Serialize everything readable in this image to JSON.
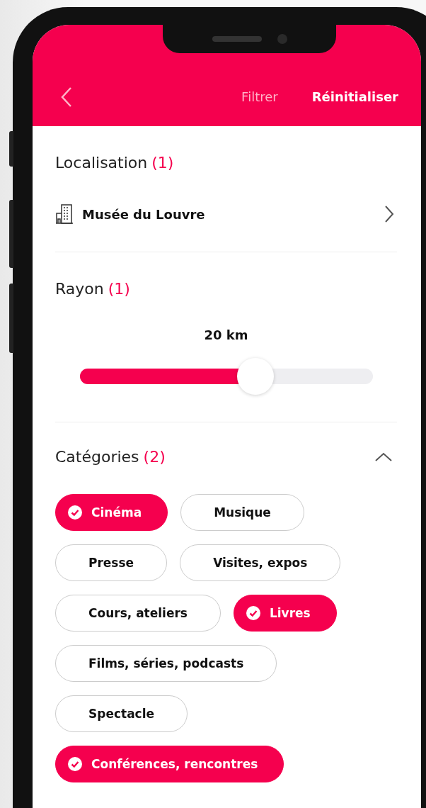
{
  "header": {
    "title": "Filtrer",
    "reset_button": "Réinitialiser"
  },
  "location": {
    "title": "Localisation",
    "count": "(1)",
    "place": "Musée du Louvre"
  },
  "radius": {
    "title": "Rayon",
    "count": "(1)",
    "reading": "20 km",
    "level": 0.6
  },
  "categories": {
    "title": "Catégories",
    "count": "(2)",
    "expanded": true,
    "chips": [
      {
        "label": "Cinéma",
        "selected": true
      },
      {
        "label": "Musique",
        "selected": false
      },
      {
        "label": "Presse",
        "selected": false
      },
      {
        "label": "Visites, expos",
        "selected": false
      },
      {
        "label": "Cours, ateliers",
        "selected": false
      },
      {
        "label": "Livres",
        "selected": true
      },
      {
        "label": "Films, séries, podcasts",
        "selected": false
      },
      {
        "label": "Spectacle",
        "selected": false
      },
      {
        "label": "Conférences, rencontres",
        "selected": true
      }
    ]
  }
}
